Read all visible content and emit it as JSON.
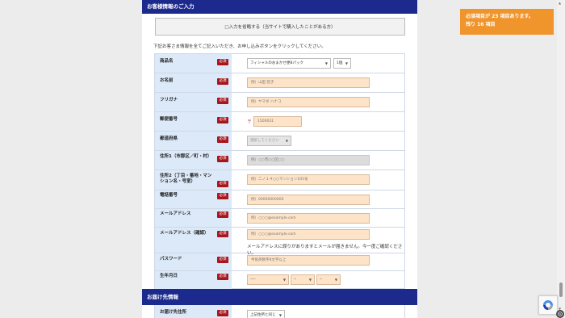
{
  "customer_section": {
    "title": "お客様情報のご入力"
  },
  "skip": {
    "label": "□入力を省略する（当サイトで購入したことがある方）"
  },
  "intro": "下記お客さま情報を全てご記入いただき、お申し込みボタンをクリックしてください。",
  "required_badge": "必須",
  "rows": {
    "product": {
      "label": "商品名",
      "value": "フィシャルのおまかせ便Bパック",
      "qty": "1個"
    },
    "name": {
      "label": "お名前",
      "placeholder": "例）山田 花子"
    },
    "furigana": {
      "label": "フリガナ",
      "placeholder": "例）ヤマダ ハナコ"
    },
    "zip": {
      "label": "郵便番号",
      "mark": "〒",
      "placeholder": "1500031"
    },
    "pref": {
      "label": "都道府県",
      "placeholder": "選択してください"
    },
    "address1": {
      "label": "住所1（市郡区／町・村）",
      "placeholder": "例）○○市○○区○○"
    },
    "address2": {
      "label": "住所2（丁目・番地・マンション名・号室）",
      "placeholder": "例）二ノ１４○○マンション101号"
    },
    "phone": {
      "label": "電話番号",
      "placeholder": "例）00000000000"
    },
    "email": {
      "label": "メールアドレス",
      "placeholder": "例）○○○@example.com"
    },
    "email_confirm": {
      "label": "メールアドレス（確認）",
      "placeholder": "例）○○○@example.com",
      "note": "メールアドレスに誤りがありますとメールが届きません。今一度ご確認ください。"
    },
    "password": {
      "label": "パスワード",
      "placeholder": "半角英数字8文字以上"
    },
    "birth": {
      "label": "生年月日",
      "year": "----",
      "month": "--",
      "day": "--"
    }
  },
  "delivery_section": {
    "title": "お届け先情報"
  },
  "delivery": {
    "label": "お届け先住所",
    "value": "上記住所と同じ"
  },
  "alert": {
    "line1": "必須項目が 23 項目あります。",
    "line2": "残り 16 項目"
  },
  "colors": {
    "section_bar": "#1b2a8c",
    "label_bg": "#dce9f8",
    "required": "#a8151b",
    "input_bg": "#fde3c8",
    "alert_bg": "#f0942c"
  },
  "icons": {
    "captcha": "recaptcha-icon",
    "accessibility": "accessibility-icon"
  }
}
